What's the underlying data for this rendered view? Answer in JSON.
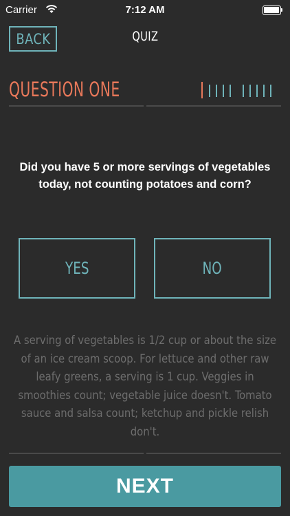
{
  "status_bar": {
    "carrier": "Carrier",
    "time": "7:12 AM",
    "wifi_icon": "wifi-icon",
    "battery_icon": "battery-icon"
  },
  "nav": {
    "back_label": "BACK",
    "title": "QUIZ"
  },
  "question": {
    "heading": "QUESTION ONE",
    "text": "Did you have 5 or more servings of vegetables today, not counting potatoes and corn?",
    "progress": {
      "current": 1,
      "total": 10
    }
  },
  "answers": {
    "yes_label": "YES",
    "no_label": "NO"
  },
  "info": {
    "text": "A serving of vegetables is 1/2 cup or about the size of an ice cream scoop. For lettuce and other raw leafy greens, a serving is 1 cup. Veggies in smoothies count; vegetable juice doesn't. Tomato sauce and salsa count; ketchup and pickle relish don't."
  },
  "footer": {
    "next_label": "NEXT"
  },
  "colors": {
    "background": "#2b2b2b",
    "accent_teal": "#6fb4ba",
    "accent_orange": "#e8785a",
    "next_button": "#4a9aa1"
  }
}
